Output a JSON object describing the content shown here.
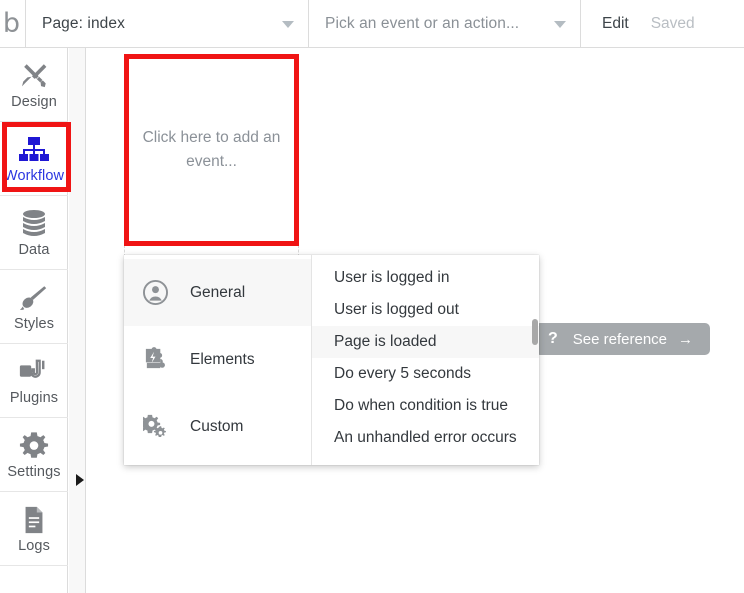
{
  "topbar": {
    "logo": "b",
    "page_select": {
      "label": "Page: index",
      "icon": "chevron-down-icon"
    },
    "action_select": {
      "label": "Pick an event or an action...",
      "icon": "chevron-down-icon"
    },
    "edit_label": "Edit",
    "saved_label": "Saved"
  },
  "sidebar": {
    "items": [
      {
        "label": "Design",
        "icon": "design-pencil-ruler-icon",
        "active": false
      },
      {
        "label": "Workflow",
        "icon": "workflow-hierarchy-icon",
        "active": true
      },
      {
        "label": "Data",
        "icon": "database-icon",
        "active": false
      },
      {
        "label": "Styles",
        "icon": "paintbrush-icon",
        "active": false
      },
      {
        "label": "Plugins",
        "icon": "plug-icon",
        "active": false
      },
      {
        "label": "Settings",
        "icon": "gear-icon",
        "active": false
      },
      {
        "label": "Logs",
        "icon": "document-lines-icon",
        "active": false
      }
    ],
    "expand_arrow_icon": "triangle-right-icon"
  },
  "canvas": {
    "event_placeholder": "Click here to add an event..."
  },
  "menu": {
    "categories": [
      {
        "label": "General",
        "icon": "user-circle-icon",
        "selected": true
      },
      {
        "label": "Elements",
        "icon": "puzzle-bolt-icon",
        "selected": false
      },
      {
        "label": "Custom",
        "icon": "gears-icon",
        "selected": false
      }
    ],
    "options": [
      {
        "label": "User is logged in",
        "selected": false
      },
      {
        "label": "User is logged out",
        "selected": false
      },
      {
        "label": "Page is loaded",
        "selected": true
      },
      {
        "label": "Do every 5 seconds",
        "selected": false
      },
      {
        "label": "Do when condition is true",
        "selected": false
      },
      {
        "label": "An unhandled error occurs",
        "selected": false
      }
    ]
  },
  "see_reference": {
    "question_icon": "question-mark-icon",
    "label": "See reference",
    "arrow": "→"
  },
  "colors": {
    "highlight_red": "#f01414",
    "active_blue": "#2b36e0",
    "icon_gray": "#808387",
    "pill_gray": "#a5a9ac"
  }
}
